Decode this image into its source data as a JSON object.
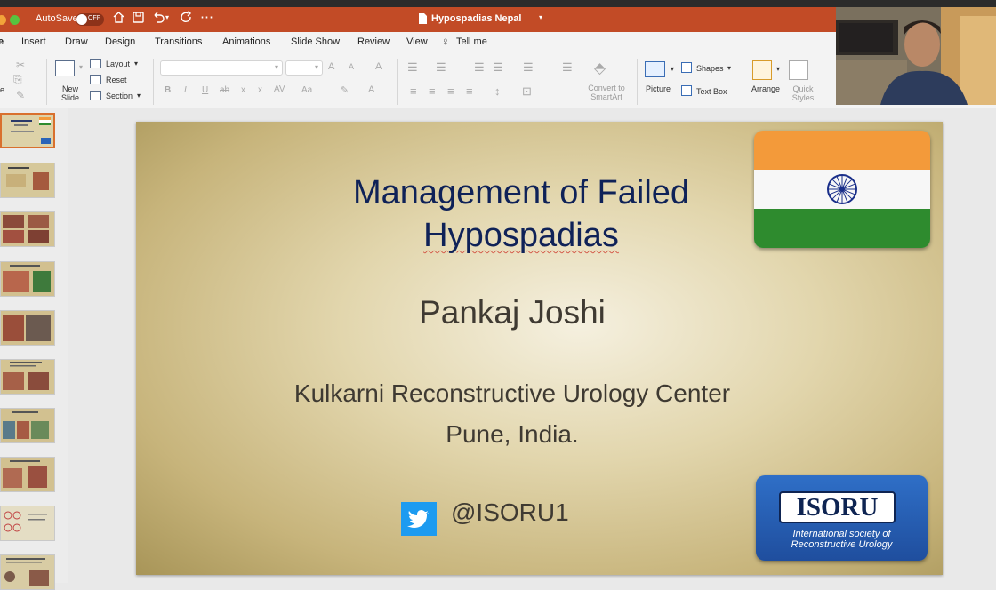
{
  "titlebar": {
    "autosave_label": "AutoSave",
    "autosave_state": "OFF",
    "document_title": "Hypospadias Nepal",
    "icons": [
      "home-icon",
      "save-icon",
      "undo-icon",
      "redo-icon",
      "more-icon"
    ]
  },
  "menu": {
    "items": [
      "e",
      "Insert",
      "Draw",
      "Design",
      "Transitions",
      "Animations",
      "Slide Show",
      "Review",
      "View",
      "Tell me"
    ]
  },
  "ribbon": {
    "layout": "Layout",
    "reset": "Reset",
    "section": "Section",
    "new_slide": "New Slide",
    "convert_smartart": "Convert to SmartArt",
    "picture": "Picture",
    "shapes": "Shapes",
    "text_box": "Text Box",
    "arrange": "Arrange",
    "quick_styles": "Quick Styles",
    "format_icons": [
      "bold-icon",
      "italic-icon",
      "underline-icon",
      "strikethrough-icon"
    ]
  },
  "slide": {
    "title_line1": "Management of Failed",
    "title_line2": "Hypospadias",
    "presenter": "Pankaj Joshi",
    "affiliation_line1": "Kulkarni Reconstructive Urology Center",
    "affiliation_line2": "Pune, India.",
    "twitter_handle": "@ISORU1",
    "logo": {
      "name": "ISORU",
      "subtitle_line1": "International society of",
      "subtitle_line2": "Reconstructive Urology"
    },
    "flag_colors": {
      "saffron": "#f39a3a",
      "white": "#f7f7f7",
      "green": "#2e8b2e",
      "chakra": "#1a2f8a"
    },
    "title_color": "#0f2258"
  },
  "thumbnails": {
    "count": 10,
    "selected_index": 0
  },
  "colors": {
    "accent": "#c24b26",
    "twitter": "#1d9bf0",
    "isoru_blue": "#2a64b8"
  }
}
